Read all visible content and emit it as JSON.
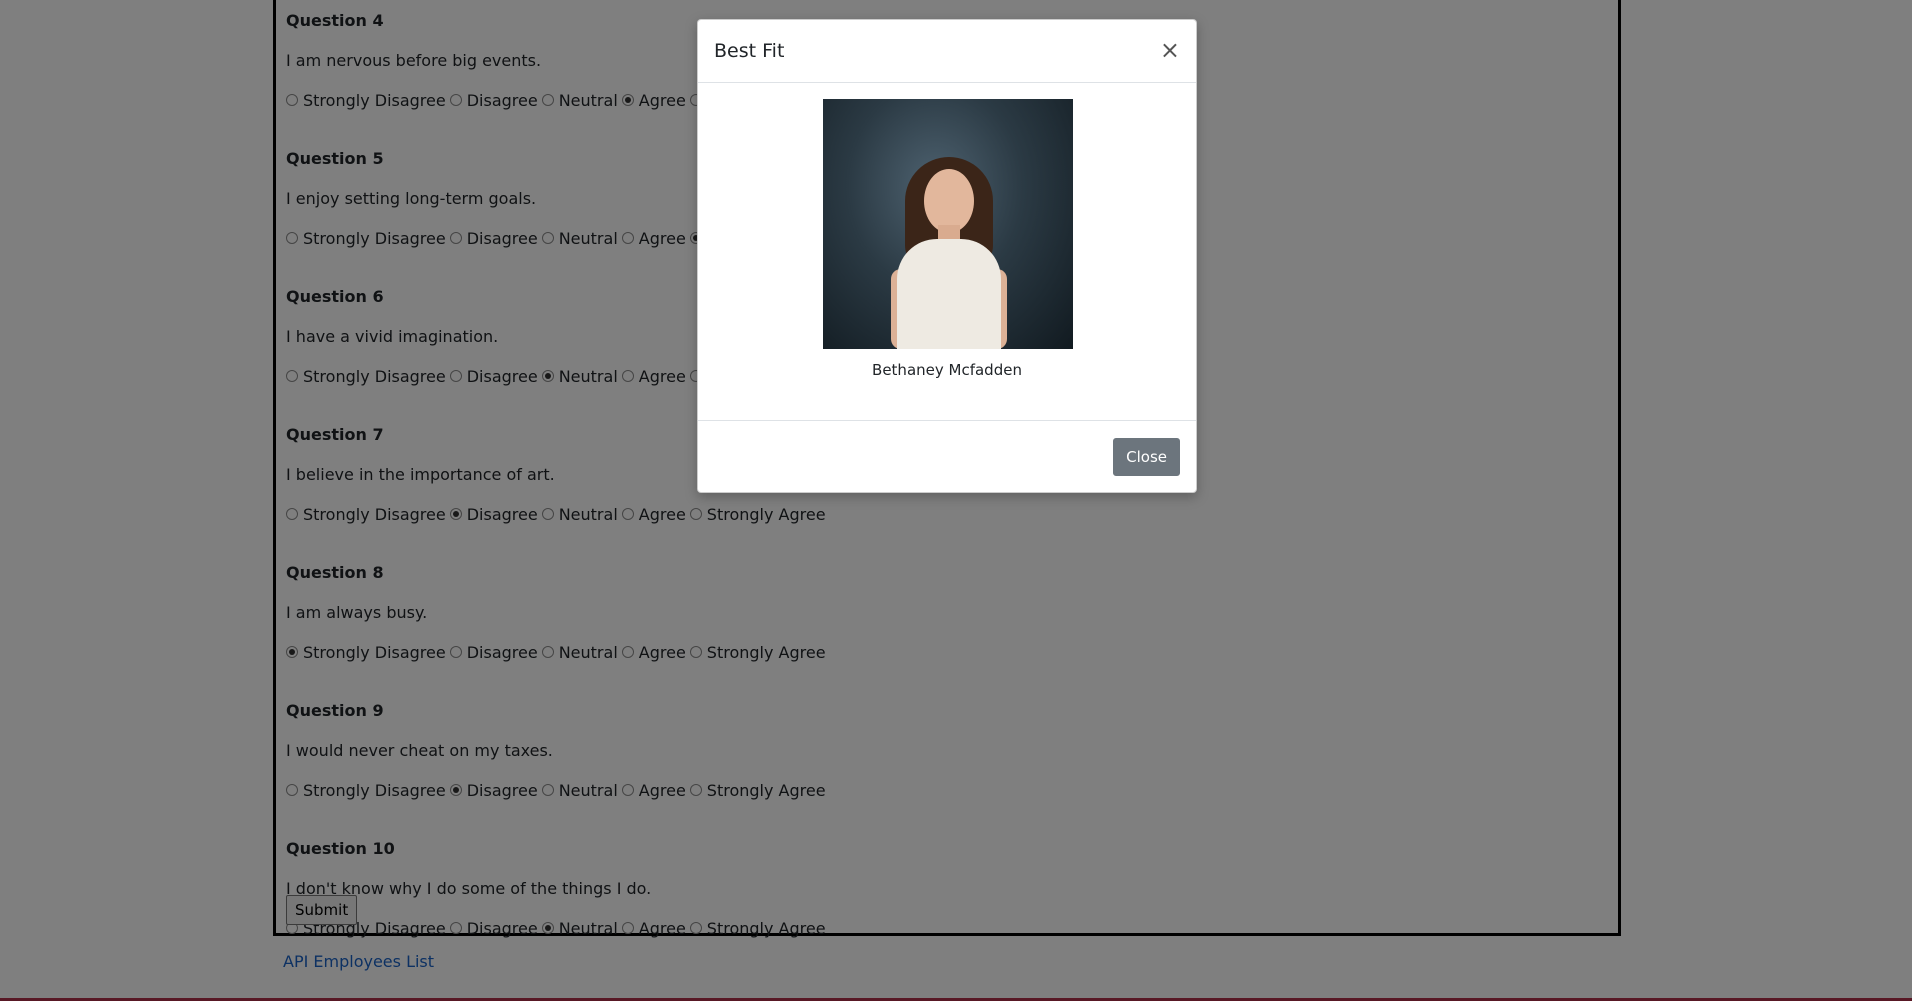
{
  "survey": {
    "options": [
      "Strongly Disagree",
      "Disagree",
      "Neutral",
      "Agree",
      "Strongly Agree"
    ],
    "questions": [
      {
        "title": "Question 4",
        "text": "I am nervous before big events.",
        "selected": 3
      },
      {
        "title": "Question 5",
        "text": "I enjoy setting long-term goals.",
        "selected": 4
      },
      {
        "title": "Question 6",
        "text": "I have a vivid imagination.",
        "selected": 2
      },
      {
        "title": "Question 7",
        "text": "I believe in the importance of art.",
        "selected": 1
      },
      {
        "title": "Question 8",
        "text": "I am always busy.",
        "selected": 0
      },
      {
        "title": "Question 9",
        "text": "I would never cheat on my taxes.",
        "selected": 1
      },
      {
        "title": "Question 10",
        "text": "I don't know why I do some of the things I do.",
        "selected": 2
      }
    ],
    "submit_label": "Submit"
  },
  "footer": {
    "link_label": "API Employees List"
  },
  "modal": {
    "title": "Best Fit",
    "close_icon": "×",
    "person_name": "Bethaney Mcfadden",
    "close_label": "Close"
  }
}
